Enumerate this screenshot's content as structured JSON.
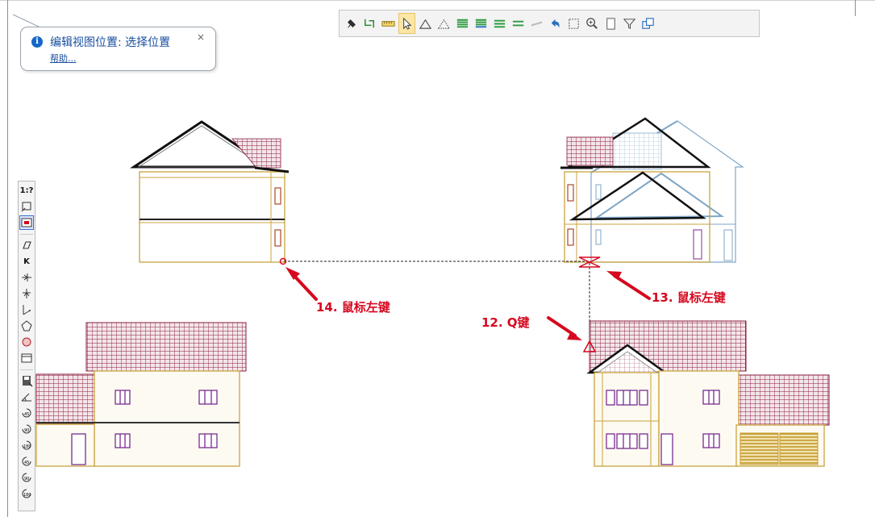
{
  "popup": {
    "title": "编辑视图位置: 选择位置",
    "help_link": "帮助...",
    "info_glyph": "i",
    "close_glyph": "×"
  },
  "left_toolbox": {
    "scale_label": "1:?",
    "top_tool_label": "K",
    "rotate_labels": [
      "45",
      "90",
      "180",
      "45",
      "90",
      "180"
    ]
  },
  "annotations": {
    "step14": "14. 鼠标左键",
    "step13": "13. 鼠标左键",
    "step12": "12. Q键"
  },
  "colors": {
    "annotation_red": "#d6081f",
    "wall_gold": "#c9a33c",
    "roof_maroon": "#8b1c3c",
    "window_purple": "#7a2c8f",
    "ghost_blue": "#7fa6c6",
    "popup_blue": "#1a4fa0"
  },
  "top_toolbar_icons": [
    "pin-icon",
    "redraw-icon",
    "ruler-icon",
    "pointer-icon",
    "triangle-icon",
    "dotted-triangle-icon",
    "layer-stack-green-icon",
    "layer-stack-blue-icon",
    "layer-stack-3-icon",
    "layer-stack-4-icon",
    "flat-layer-icon",
    "undo-arrow-icon",
    "zoom-extents-icon",
    "zoom-in-icon",
    "page-icon",
    "filter-icon",
    "window-restore-icon"
  ]
}
